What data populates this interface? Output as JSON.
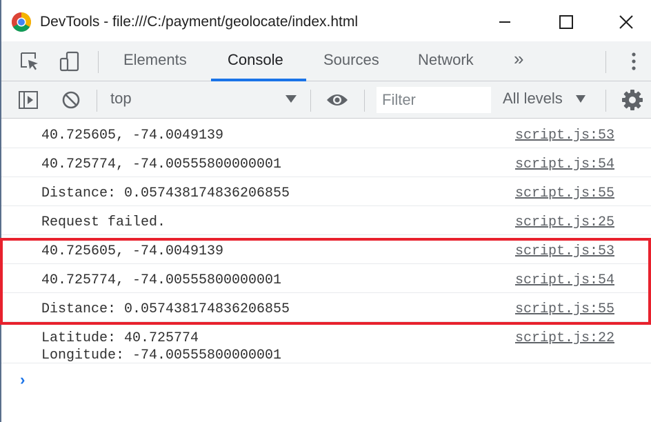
{
  "window": {
    "title": "DevTools - file:///C:/payment/geolocate/index.html"
  },
  "tabs": [
    {
      "label": "Elements"
    },
    {
      "label": "Console"
    },
    {
      "label": "Sources"
    },
    {
      "label": "Network"
    }
  ],
  "more_tabs_label": "»",
  "console_toolbar": {
    "context": "top",
    "filter_placeholder": "Filter",
    "levels": "All levels"
  },
  "messages": [
    {
      "text": "40.725605, -74.0049139",
      "source": "script.js:53"
    },
    {
      "text": "40.725774, -74.00555800000001",
      "source": "script.js:54"
    },
    {
      "text": "Distance: 0.057438174836206855",
      "source": "script.js:55"
    },
    {
      "text": "Request failed.",
      "source": "script.js:25"
    },
    {
      "text": "40.725605, -74.0049139",
      "source": "script.js:53"
    },
    {
      "text": "40.725774, -74.00555800000001",
      "source": "script.js:54"
    },
    {
      "text": "Distance: 0.057438174836206855",
      "source": "script.js:55"
    },
    {
      "text": "Latitude: 40.725774",
      "text2": "Longitude: -74.00555800000001",
      "source": "script.js:22"
    }
  ],
  "prompt_symbol": "›",
  "colors": {
    "highlight": "#e8212d",
    "accent": "#1a73e8"
  },
  "icons": [
    "chrome-logo-icon",
    "minimize-icon",
    "maximize-icon",
    "close-icon",
    "inspect-element-icon",
    "device-toolbar-icon",
    "kebab-menu-icon",
    "sidebar-toggle-icon",
    "clear-console-icon",
    "eye-icon",
    "settings-gear-icon"
  ]
}
